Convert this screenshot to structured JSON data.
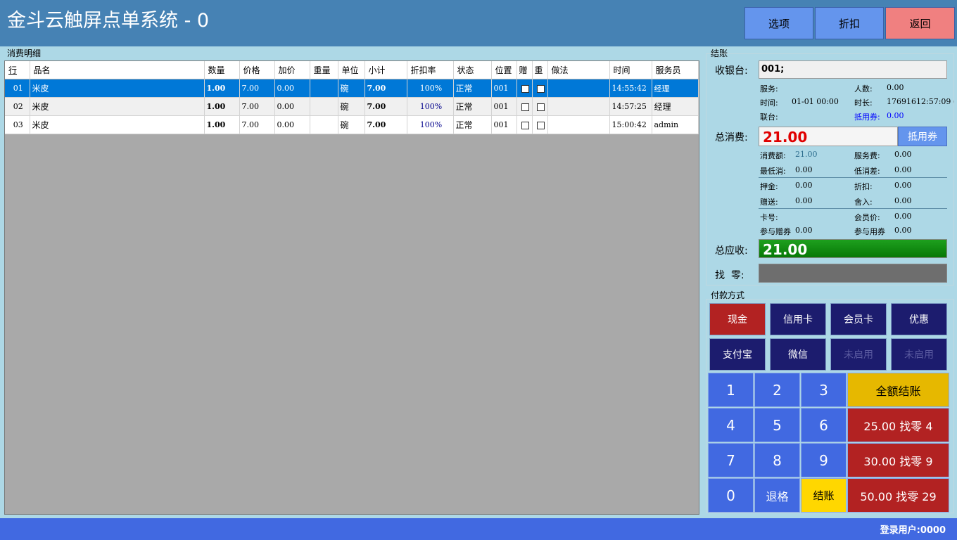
{
  "header": {
    "title": "金斗云触屏点单系统 - 0",
    "buttons": {
      "options": "选项",
      "discount": "折扣",
      "back": "返回"
    }
  },
  "detail": {
    "group_label": "消费明细",
    "columns": [
      "行",
      "品名",
      "数量",
      "价格",
      "加价",
      "重量",
      "单位",
      "小计",
      "折扣率",
      "状态",
      "位置",
      "赠",
      "重",
      "做法",
      "时间",
      "服务员"
    ],
    "rows": [
      {
        "row": "01",
        "name": "米皮",
        "qty": "1.00",
        "price": "7.00",
        "extra": "0.00",
        "weight": "",
        "unit": "碗",
        "subtotal": "7.00",
        "rate": "100%",
        "status": "正常",
        "pos": "001",
        "gift": "",
        "repeat": "",
        "method": "",
        "time": "14:55:42",
        "waiter": "经理"
      },
      {
        "row": "02",
        "name": "米皮",
        "qty": "1.00",
        "price": "7.00",
        "extra": "0.00",
        "weight": "",
        "unit": "碗",
        "subtotal": "7.00",
        "rate": "100%",
        "status": "正常",
        "pos": "001",
        "gift": "",
        "repeat": "",
        "method": "",
        "time": "14:57:25",
        "waiter": "经理"
      },
      {
        "row": "03",
        "name": "米皮",
        "qty": "1.00",
        "price": "7.00",
        "extra": "0.00",
        "weight": "",
        "unit": "碗",
        "subtotal": "7.00",
        "rate": "100%",
        "status": "正常",
        "pos": "001",
        "gift": "",
        "repeat": "",
        "method": "",
        "time": "15:00:42",
        "waiter": "admin"
      }
    ]
  },
  "checkout": {
    "group_label": "结账",
    "cashier_label": "收银台:",
    "cashier_value": "001;",
    "service_label": "服务:",
    "service_value": "",
    "people_label": "人数:",
    "people_value": "0.00",
    "time_label": "时间:",
    "time_value": "01-01 00:00",
    "duration_label": "时长:",
    "duration_value": "17691612:57:09 (",
    "joint_label": "联台:",
    "joint_value": "",
    "coupon_label": "抵用券:",
    "coupon_value": "0.00",
    "total_label": "总消费:",
    "total_value": "21.00",
    "coupon_button": "抵用券",
    "consume_label": "消费额:",
    "consume_value": "21.00",
    "service_fee_label": "服务费:",
    "service_fee_value": "0.00",
    "min_consume_label": "最低消:",
    "min_consume_value": "0.00",
    "low_diff_label": "低消差:",
    "low_diff_value": "0.00",
    "deposit_label": "押金:",
    "deposit_value": "0.00",
    "discount_label": "折扣:",
    "discount_value": "0.00",
    "gift_label": "赠送:",
    "gift_value": "0.00",
    "rounding_label": "舍入:",
    "rounding_value": "0.00",
    "card_label": "卡号:",
    "card_value": "",
    "member_price_label": "会员价:",
    "member_price_value": "0.00",
    "gift_coupon_label": "参与赠券",
    "gift_coupon_value": "0.00",
    "use_coupon_label": "参与用券",
    "use_coupon_value": "0.00",
    "receivable_label": "总应收:",
    "receivable_value": "21.00",
    "change_label": "找  零:",
    "change_value": ""
  },
  "payment": {
    "group_label": "付款方式",
    "methods": [
      "现金",
      "信用卡",
      "会员卡",
      "优惠",
      "支付宝",
      "微信",
      "未启用",
      "未启用"
    ],
    "keys": [
      "1",
      "2",
      "3",
      "4",
      "5",
      "6",
      "7",
      "8",
      "9",
      "0"
    ],
    "backspace": "退格",
    "checkout": "结账",
    "full_checkout": "全额结账",
    "quick": [
      "25.00 找零 4",
      "30.00 找零 9",
      "50.00 找零 29"
    ]
  },
  "footer": {
    "user_label": "登录用户:",
    "user_value": "0000"
  },
  "colors": {
    "header": "#4682b4",
    "selected_row": "#0078d7",
    "cash": "#b22222",
    "keypad": "#4169e1",
    "receivable": "#1ea01e"
  }
}
